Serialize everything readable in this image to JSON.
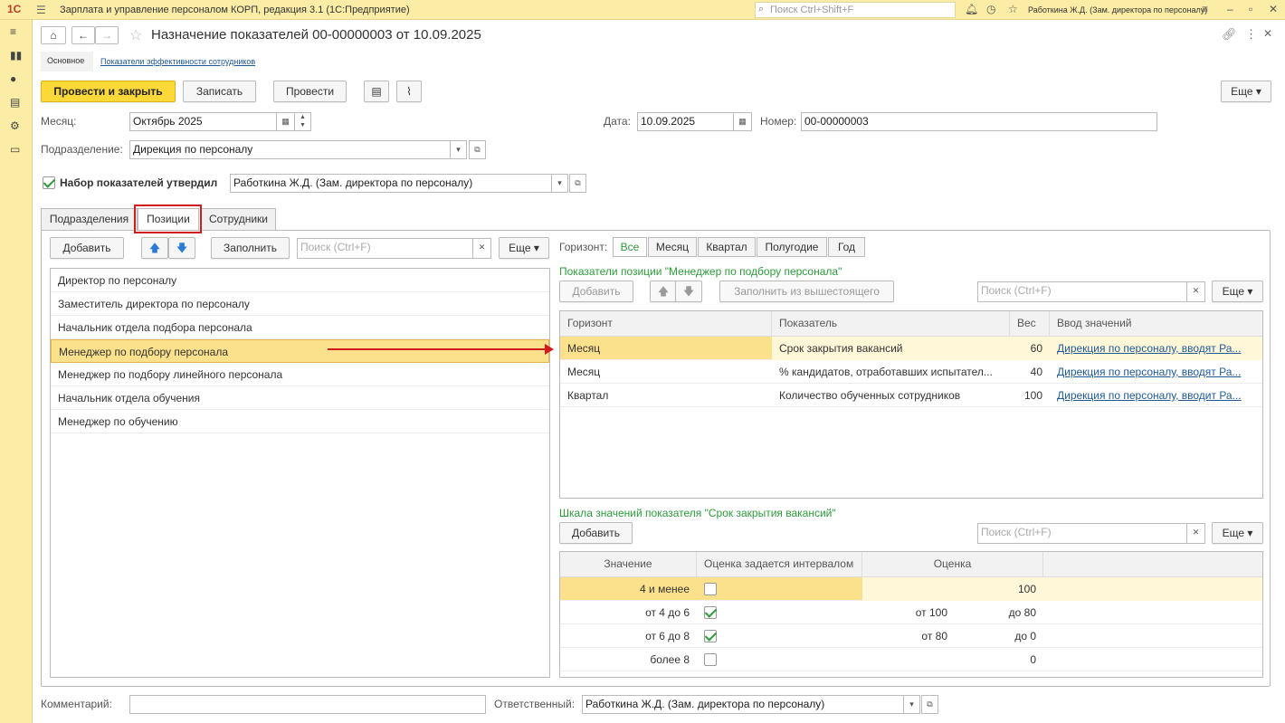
{
  "titlebar": {
    "logo": "1С",
    "app_title": "Зарплата и управление персоналом КОРП, редакция 3.1  (1С:Предприятие)",
    "search_placeholder": "Поиск Ctrl+Shift+F",
    "user": "Работкина Ж.Д. (Зам. директора по персоналу)"
  },
  "document": {
    "title": "Назначение показателей 00-00000003 от 10.09.2025"
  },
  "subnav": {
    "main": "Основное",
    "link": "Показатели эффективности сотрудников"
  },
  "toolbar": {
    "post_close": "Провести и закрыть",
    "save": "Записать",
    "post": "Провести",
    "more": "Еще"
  },
  "form": {
    "month_label": "Месяц:",
    "month_value": "Октябрь 2025",
    "date_label": "Дата:",
    "date_value": "10.09.2025",
    "number_label": "Номер:",
    "number_value": "00-00000003",
    "dept_label": "Подразделение:",
    "dept_value": "Дирекция по персоналу",
    "approved_label": "Набор показателей утвердил",
    "approved_value": "Работкина Ж.Д. (Зам. директора по персоналу)"
  },
  "tabs": [
    {
      "label": "Подразделения"
    },
    {
      "label": "Позиции"
    },
    {
      "label": "Сотрудники"
    }
  ],
  "left_panel": {
    "add": "Добавить",
    "fill": "Заполнить",
    "search_placeholder": "Поиск (Ctrl+F)",
    "more": "Еще",
    "items": [
      "Директор по персоналу",
      "Заместитель директора по персоналу",
      "Начальник отдела подбора персонала",
      "Менеджер по подбору персонала",
      "Менеджер по подбору линейного персонала",
      "Начальник отдела обучения",
      "Менеджер по обучению"
    ]
  },
  "horizon": {
    "label": "Горизонт:",
    "options": [
      "Все",
      "Месяц",
      "Квартал",
      "Полугодие",
      "Год"
    ]
  },
  "indicators": {
    "title": "Показатели позиции \"Менеджер по подбору персонала\"",
    "add": "Добавить",
    "fill_parent": "Заполнить из вышестоящего",
    "search_placeholder": "Поиск (Ctrl+F)",
    "more": "Еще",
    "columns": [
      "Горизонт",
      "Показатель",
      "Вес",
      "Ввод значений"
    ],
    "rows": [
      {
        "horizon": "Месяц",
        "indicator": "Срок закрытия вакансий",
        "weight": "60",
        "input": "Дирекция по персоналу, вводят Ра..."
      },
      {
        "horizon": "Месяц",
        "indicator": "% кандидатов, отработавших испытател...",
        "weight": "40",
        "input": "Дирекция по персоналу, вводят Ра..."
      },
      {
        "horizon": "Квартал",
        "indicator": "Количество обученных сотрудников",
        "weight": "100",
        "input": "Дирекция по персоналу, вводит Ра..."
      }
    ]
  },
  "scale": {
    "title": "Шкала значений показателя \"Срок закрытия вакансий\"",
    "add": "Добавить",
    "search_placeholder": "Поиск (Ctrl+F)",
    "more": "Еще",
    "columns": [
      "Значение",
      "Оценка задается интервалом",
      "Оценка"
    ],
    "rows": [
      {
        "value": "4 и менее",
        "interval": false,
        "from": "",
        "to": "100"
      },
      {
        "value": "от 4 до 6",
        "interval": true,
        "from": "от 100",
        "to": "до 80"
      },
      {
        "value": "от 6 до 8",
        "interval": true,
        "from": "от 80",
        "to": "до 0"
      },
      {
        "value": "более 8",
        "interval": false,
        "from": "",
        "to": "0"
      }
    ]
  },
  "footer": {
    "comment_label": "Комментарий:",
    "comment_value": "",
    "responsible_label": "Ответственный:",
    "responsible_value": "Работкина Ж.Д. (Зам. директора по персоналу)"
  },
  "colors": {
    "accent_yellow": "#fcd838",
    "selection": "#fbe18c",
    "green": "#2c9b3a",
    "link": "#1f5a96",
    "annotation_red": "#d01c1c"
  }
}
